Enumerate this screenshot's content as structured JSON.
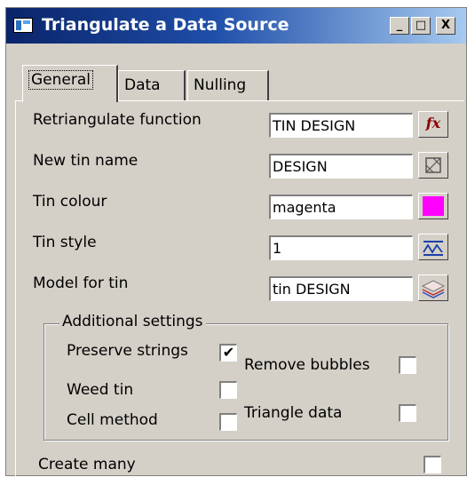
{
  "window": {
    "title": "Triangulate a Data Source",
    "buttons": {
      "minimize": "_",
      "maximize": "□",
      "close": "X"
    }
  },
  "tabs": [
    {
      "label": "General",
      "active": true
    },
    {
      "label": "Data",
      "active": false
    },
    {
      "label": "Nulling",
      "active": false
    }
  ],
  "rows": {
    "retriangulate": {
      "label": "Retriangulate function",
      "value": "TIN DESIGN",
      "button": "fx"
    },
    "new_tin": {
      "label": "New tin name",
      "value": "DESIGN"
    },
    "colour": {
      "label": "Tin colour",
      "value": "magenta",
      "swatch": "#ff00ff"
    },
    "style": {
      "label": "Tin style",
      "value": "1"
    },
    "model": {
      "label": "Model for tin",
      "value": "tin DESIGN"
    }
  },
  "additional": {
    "title": "Additional settings",
    "preserve_strings": {
      "label": "Preserve strings",
      "checked": true,
      "mark": "✔"
    },
    "remove_bubbles": {
      "label": "Remove bubbles",
      "checked": false
    },
    "weed_tin": {
      "label": "Weed tin",
      "checked": false
    },
    "triangle_data": {
      "label": "Triangle data",
      "checked": false
    },
    "cell_method": {
      "label": "Cell method",
      "checked": false
    }
  },
  "create_many": {
    "label": "Create many",
    "checked": false
  }
}
